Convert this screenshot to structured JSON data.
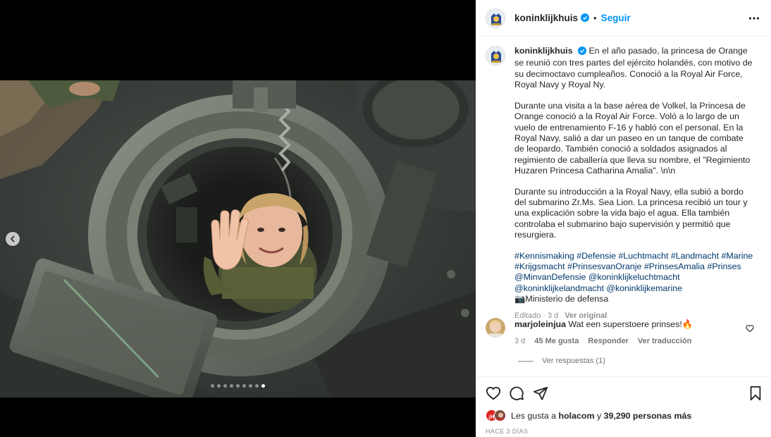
{
  "post": {
    "username": "koninklijkhuis",
    "separator": "•",
    "follow_label": "Seguir",
    "more_icon": "more-options-icon"
  },
  "media": {
    "carousel_total": 9,
    "carousel_active": 9,
    "prev_icon": "chevron-left-icon"
  },
  "caption": {
    "username": "koninklijkhuis",
    "p1": "En el año pasado, la princesa de Orange se reunió con tres partes del ejército holandés, con motivo de su decimoctavo cumpleaños. Conoció a la Royal Air Force, Royal Navy y Royal Ny.",
    "p2": "Durante una visita a la base aérea de Volkel, la Princesa de Orange conoció a la Royal Air Force. Voló a lo largo de un vuelo de entrenamiento F-16 y habló con el personal. En la Royal Navy, salió a dar un paseo en un tanque de combate de leopardo. También conoció a soldados asignados al regimiento de caballería que lleva su nombre, el \"Regimiento Huzaren Princesa Catharina Amalia\". \\n\\n",
    "p3": "Durante su introducción a la Royal Navy, ella subió a bordo del submarino Zr.Ms. Sea Lion. La princesa recibió un tour y una explicación sobre la vida bajo el agua. Ella también controlaba el submarino bajo supervisión y permitió que resurgiera.",
    "tags": [
      "#Kennismaking",
      "#Defensie",
      "#Luchtmacht",
      "#Landmacht",
      "#Marine",
      "#Krijgsmacht",
      "#PrinsesvanOranje",
      "#PrinsesAmalia",
      "#Prinses"
    ],
    "mentions": [
      "@MinvanDefensie",
      "@koninklijkeluchtmacht",
      "@koninklijkelandmacht",
      "@koninklijkemarine"
    ],
    "credit": "📷Ministerio de defensa",
    "edited": "Editado",
    "age": "3 d",
    "see_original": "Ver original"
  },
  "comment": {
    "username": "marjoleinjua",
    "text": "Wat een superstoere prinses!🔥",
    "age": "3 d",
    "likes": "45 Me gusta",
    "reply": "Responder",
    "translate": "Ver traducción",
    "view_replies": "Ver respuestas (1)"
  },
  "actions": {
    "likes_prefix": "Les gusta a",
    "likes_user": "holacom",
    "likes_conj": "y",
    "likes_count": "39,290 personas más",
    "date": "HACE 3 DÍAS"
  },
  "colors": {
    "link_blue": "#0095f6",
    "hashtag": "#00376b",
    "muted": "#8e8e8e",
    "verified": "#0095f6"
  }
}
